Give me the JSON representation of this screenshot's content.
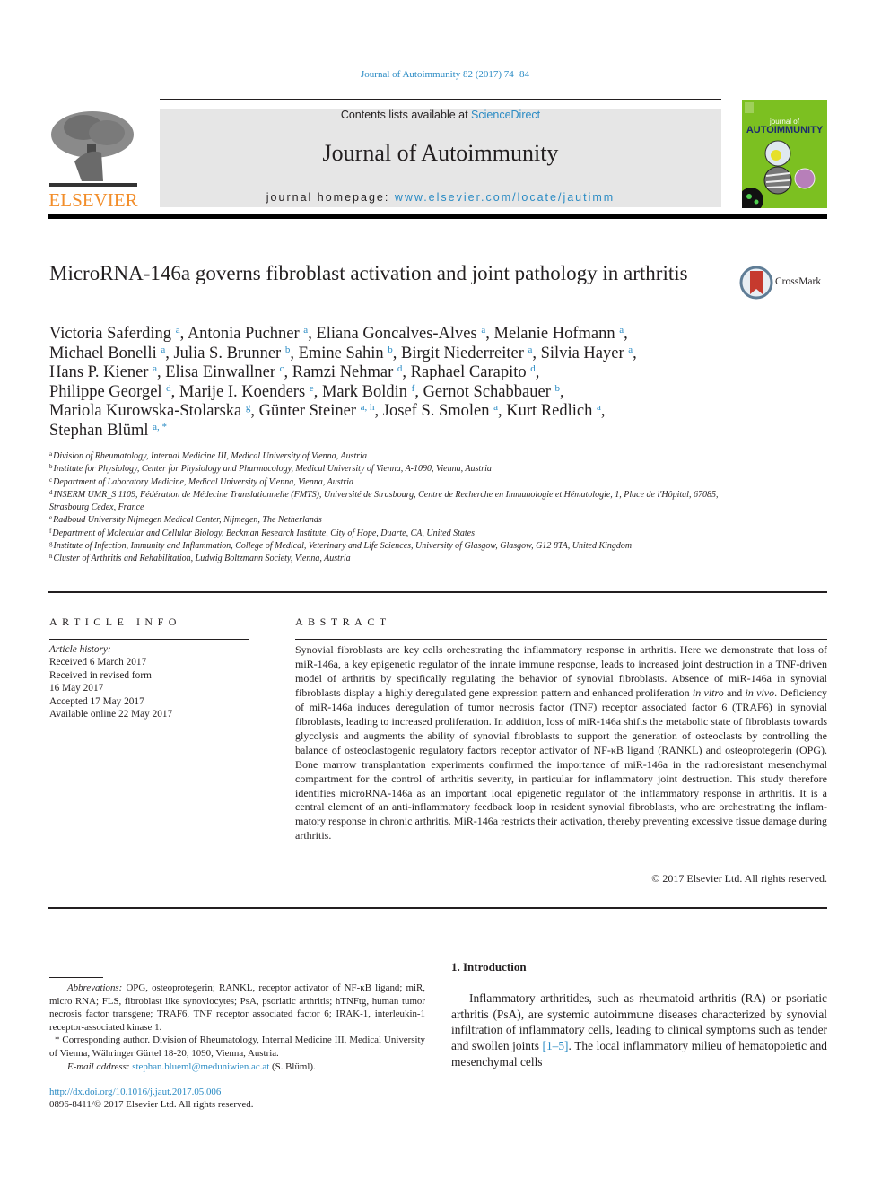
{
  "header": {
    "citation": "Journal of Autoimmunity 82 (2017) 74−84",
    "publisher_logo_text": "ELSEVIER",
    "contents_prefix": "Contents lists available at ",
    "contents_link": "ScienceDirect",
    "journal_name": "Journal of Autoimmunity",
    "homepage_prefix": "journal homepage: ",
    "homepage_link": "www.elsevier.com/locate/jautimm",
    "cover_small": "journal of",
    "cover_big": "AUTOIMMUNITY",
    "colors": {
      "link": "#2a8bc4",
      "elsevier_orange": "#f28e2b",
      "cover_green": "#7cc021",
      "banner_gray": "#e6e6e6"
    }
  },
  "article": {
    "title": "MicroRNA-146a governs fibroblast activation and joint pathology in arthritis",
    "crossmark_label": "CrossMark",
    "authors": [
      {
        "name": "Victoria Saferding",
        "aff": "a"
      },
      {
        "name": "Antonia Puchner",
        "aff": "a"
      },
      {
        "name": "Eliana Goncalves-Alves",
        "aff": "a"
      },
      {
        "name": "Melanie Hofmann",
        "aff": "a"
      },
      {
        "name": "Michael Bonelli",
        "aff": "a"
      },
      {
        "name": "Julia S. Brunner",
        "aff": "b"
      },
      {
        "name": "Emine Sahin",
        "aff": "b"
      },
      {
        "name": "Birgit Niederreiter",
        "aff": "a"
      },
      {
        "name": "Silvia Hayer",
        "aff": "a"
      },
      {
        "name": "Hans P. Kiener",
        "aff": "a"
      },
      {
        "name": "Elisa Einwallner",
        "aff": "c"
      },
      {
        "name": "Ramzi Nehmar",
        "aff": "d"
      },
      {
        "name": "Raphael Carapito",
        "aff": "d"
      },
      {
        "name": "Philippe Georgel",
        "aff": "d"
      },
      {
        "name": "Marije I. Koenders",
        "aff": "e"
      },
      {
        "name": "Mark Boldin",
        "aff": "f"
      },
      {
        "name": "Gernot Schabbauer",
        "aff": "b"
      },
      {
        "name": "Mariola Kurowska-Stolarska",
        "aff": "g"
      },
      {
        "name": "Günter Steiner",
        "aff": "a, h"
      },
      {
        "name": "Josef S. Smolen",
        "aff": "a"
      },
      {
        "name": "Kurt Redlich",
        "aff": "a"
      },
      {
        "name": "Stephan Blüml",
        "aff": "a, *"
      }
    ],
    "affiliations": [
      {
        "key": "a",
        "text": "Division of Rheumatology, Internal Medicine III, Medical University of Vienna, Austria"
      },
      {
        "key": "b",
        "text": "Institute for Physiology, Center for Physiology and Pharmacology, Medical University of Vienna, A-1090, Vienna, Austria"
      },
      {
        "key": "c",
        "text": "Department of Laboratory Medicine, Medical University of Vienna, Vienna, Austria"
      },
      {
        "key": "d",
        "text": "INSERM UMR_S 1109, Fédération de Médecine Translationnelle (FMTS), Université de Strasbourg, Centre de Recherche en Immunologie et Hématologie, 1, Place de l'Hôpital, 67085, Strasbourg Cedex, France"
      },
      {
        "key": "e",
        "text": "Radboud University Nijmegen Medical Center, Nijmegen, The Netherlands"
      },
      {
        "key": "f",
        "text": "Department of Molecular and Cellular Biology, Beckman Research Institute, City of Hope, Duarte, CA, United States"
      },
      {
        "key": "g",
        "text": "Institute of Infection, Immunity and Inflammation, College of Medical, Veterinary and Life Sciences, University of Glasgow, Glasgow, G12 8TA, United Kingdom"
      },
      {
        "key": "h",
        "text": "Cluster of Arthritis and Rehabilitation, Ludwig Boltzmann Society, Vienna, Austria"
      }
    ]
  },
  "article_info": {
    "heading": "ARTICLE INFO",
    "history_label": "Article history:",
    "history": [
      "Received 6 March 2017",
      "Received in revised form",
      "16 May 2017",
      "Accepted 17 May 2017",
      "Available online 22 May 2017"
    ]
  },
  "abstract": {
    "heading": "ABSTRACT",
    "part1": "Synovial fibroblasts are key cells orchestrating the inflammatory response in arthritis. Here we demonstrate that loss of miR-146a, a key epigenetic regulator of the innate immune response, leads to increased joint destruction in a TNF-driven model of arthritis by specifically regulating the behavior of synovial fibroblasts. Absence of miR-146a in synovial fibroblasts display a highly deregulated gene expression pattern and enhanced proliferation ",
    "italic1": "in vitro",
    "part2": " and ",
    "italic2": "in vivo",
    "part3": ". Deficiency of miR-146a induces deregulation of tumor necrosis factor (TNF) receptor associated factor 6 (TRAF6) in synovial fibroblasts, leading to increased proliferation. In addition, loss of miR-146a shifts the metabolic state of fibroblasts towards glycolysis and augments the ability of synovial fibroblasts to support the generation of osteo­clasts by controlling the balance of osteoclastogenic regulatory factors receptor activator of NF-κB ligand (RANKL) and osteoprotegerin (OPG). Bone marrow transplantation experiments confirmed the impor­tance of miR-146a in the radioresistant mesenchymal compartment for the control of arthritis severity, in particular for inflammatory joint destruction. This study therefore identifies microRNA-146a as an important local epigenetic regulator of the inflammatory response in arthritis. It is a central element of an anti-inflammatory feedback loop in resident synovial fibroblasts, who are orchestrating the inflam­matory response in chronic arthritis. MiR-146a restricts their activation, thereby preventing excessive tissue damage during arthritis.",
    "copyright": "© 2017 Elsevier Ltd. All rights reserved."
  },
  "footnotes": {
    "abbrev_label": "Abbrevations:",
    "abbrev_text": " OPG, osteoprotegerin; RANKL, receptor activator of NF-κB ligand; miR, micro RNA; FLS, fibroblast like synoviocytes; PsA, psoriatic arthritis; hTNFtg, human tumor necrosis factor transgene; TRAF6, TNF receptor associated factor 6; IRAK-1, interleukin-1 receptor-associated kinase 1.",
    "corresponding": "* Corresponding author. Division of Rheumatology, Internal Medicine III, Medical University of Vienna, Währinger Gürtel 18-20, 1090, Vienna, Austria.",
    "email_label": "E-mail address:",
    "email": "stephan.blueml@meduniwien.ac.at",
    "email_suffix": " (S. Blüml).",
    "doi": "http://dx.doi.org/10.1016/j.jaut.2017.05.006",
    "issn": "0896-8411/© 2017 Elsevier Ltd. All rights reserved."
  },
  "introduction": {
    "heading": "1.  Introduction",
    "text_before_ref": "Inflammatory arthritides, such as rheumatoid arthritis (RA) or psoriatic arthritis (PsA), are systemic autoimmune diseases char­acterized by synovial infiltration of inflammatory cells, leading to clinical symptoms such as tender and swollen joints ",
    "ref": "[1–5]",
    "text_after_ref": ". The local inflammatory milieu of hematopoietic and mesenchymal cells"
  }
}
